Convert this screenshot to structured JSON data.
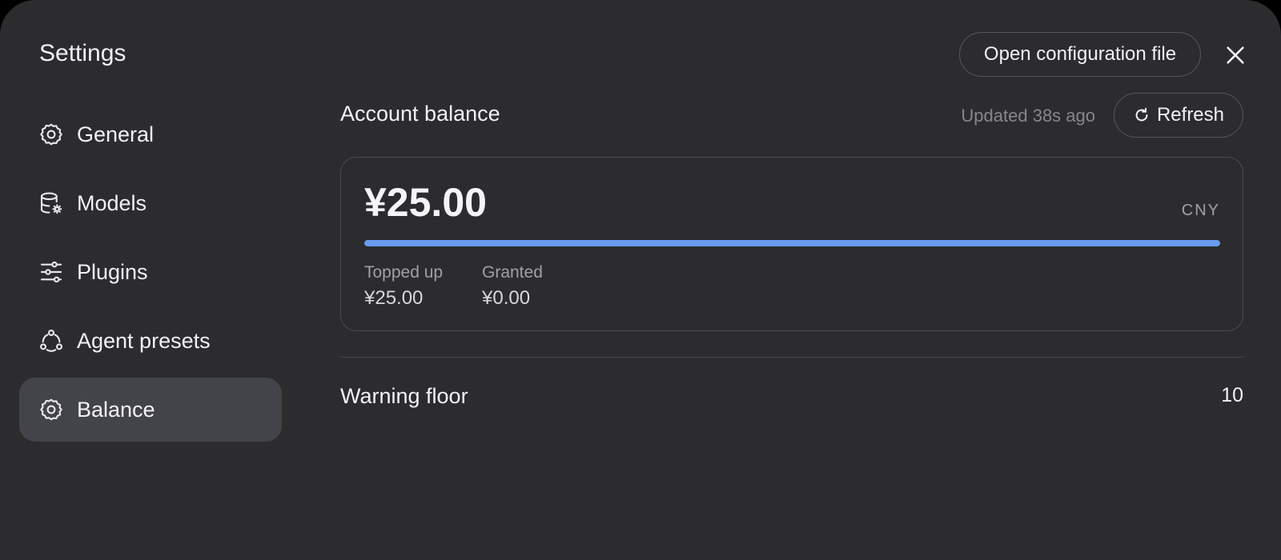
{
  "settings": {
    "title": "Settings"
  },
  "sidebar": {
    "items": [
      {
        "label": "General",
        "icon": "gear-icon"
      },
      {
        "label": "Models",
        "icon": "database-gear-icon"
      },
      {
        "label": "Plugins",
        "icon": "sliders-icon"
      },
      {
        "label": "Agent presets",
        "icon": "nodes-icon"
      },
      {
        "label": "Balance",
        "icon": "gear-icon",
        "active": true
      }
    ]
  },
  "header": {
    "open_config_label": "Open configuration file"
  },
  "balance": {
    "section_title": "Account balance",
    "updated_text": "Updated 38s ago",
    "refresh_label": "Refresh",
    "amount": "¥25.00",
    "currency": "CNY",
    "bar_fill_percent": 100,
    "topped_up_label": "Topped up",
    "topped_up_value": "¥25.00",
    "granted_label": "Granted",
    "granted_value": "¥0.00"
  },
  "warning": {
    "label": "Warning floor",
    "value": "10"
  },
  "colors": {
    "background": "#2c2c2e",
    "sidebar_active": "#43444a",
    "accent_bar": "#6a9bf2",
    "muted_text": "#86878d"
  }
}
